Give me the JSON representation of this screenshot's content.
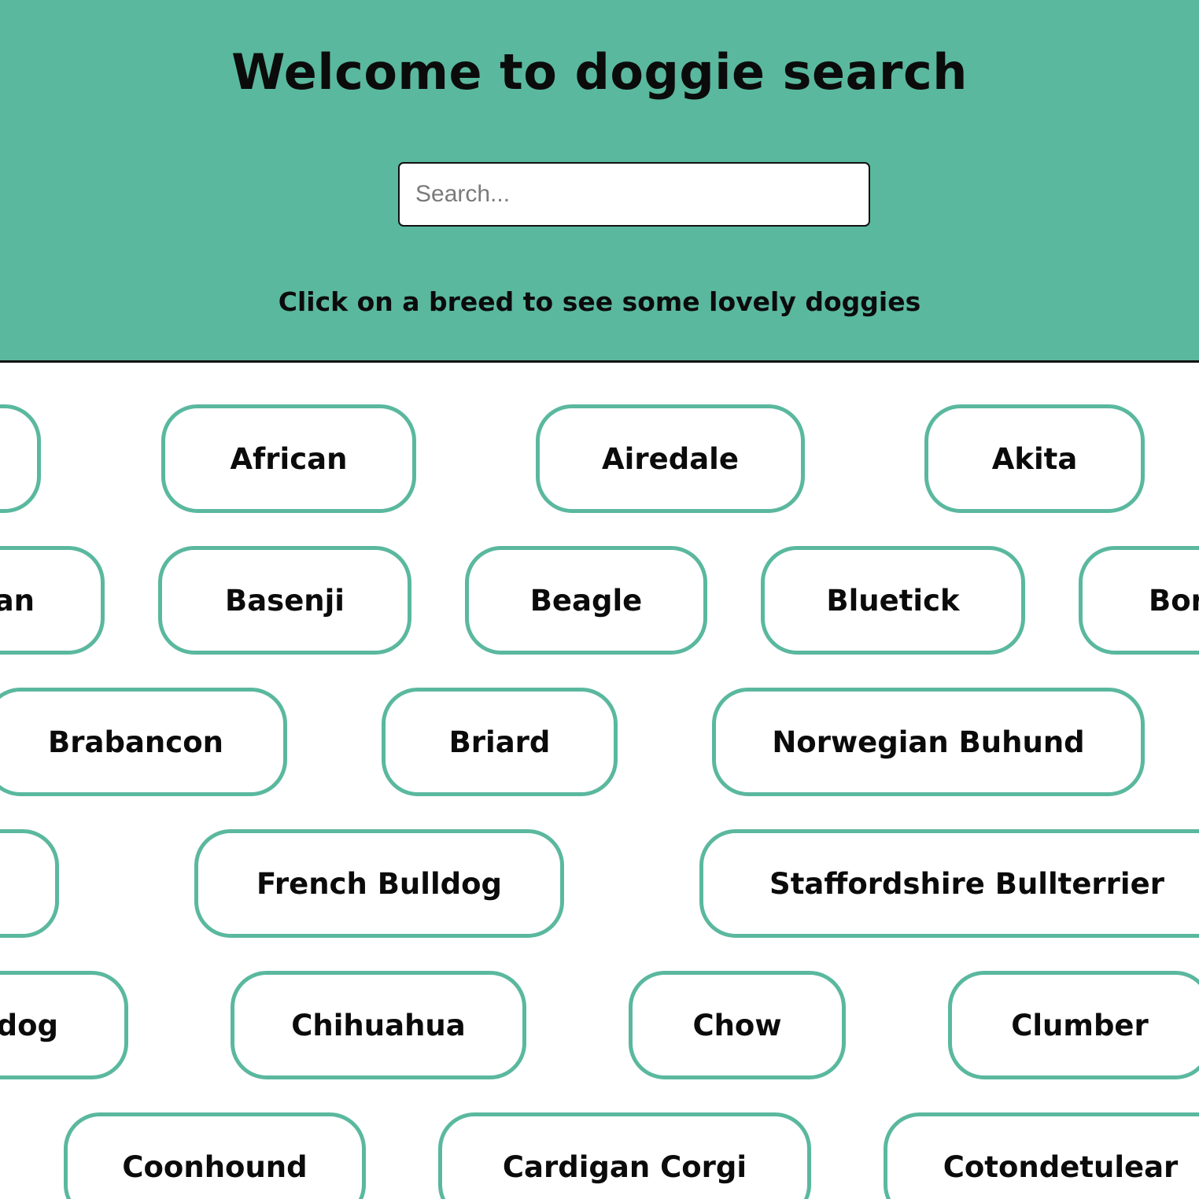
{
  "header": {
    "title": "Welcome to doggie search",
    "subtitle": "Click on a breed to see some lovely doggies"
  },
  "search": {
    "placeholder": "Search..."
  },
  "colors": {
    "accent": "#5ab89e",
    "text": "#0b0b0b",
    "border_dark": "#111111"
  },
  "breeds": [
    {
      "label": ""
    },
    {
      "label": "African"
    },
    {
      "label": "Airedale"
    },
    {
      "label": "Akita"
    },
    {
      "label": "an"
    },
    {
      "label": "Basenji"
    },
    {
      "label": "Beagle"
    },
    {
      "label": "Bluetick"
    },
    {
      "label": "Bor"
    },
    {
      "label": "Brabancon"
    },
    {
      "label": "Briard"
    },
    {
      "label": "Norwegian Buhund"
    },
    {
      "label": ""
    },
    {
      "label": "French Bulldog"
    },
    {
      "label": "Staffordshire Bullterrier"
    },
    {
      "label": "edog"
    },
    {
      "label": "Chihuahua"
    },
    {
      "label": "Chow"
    },
    {
      "label": "Clumber"
    },
    {
      "label": "Coonhound"
    },
    {
      "label": "Cardigan Corgi"
    },
    {
      "label": "Cotondetulear"
    }
  ]
}
